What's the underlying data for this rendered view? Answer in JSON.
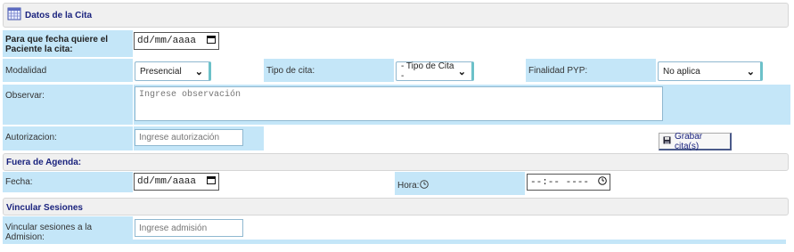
{
  "section_cita": {
    "title": "Datos de la Cita"
  },
  "fecha_cita": {
    "label_line1": "Para que fecha quiere el",
    "label_line2": "Paciente la cita:",
    "value": "dd/mm/aaaa"
  },
  "modalidad": {
    "label": "Modalidad",
    "selected": "Presencial"
  },
  "tipo_cita": {
    "label": "Tipo de cita:",
    "selected": "- Tipo de Cita -"
  },
  "finalidad": {
    "label": "Finalidad PYP:",
    "selected": "No aplica"
  },
  "observar": {
    "label": "Observar:",
    "placeholder": "Ingrese observación"
  },
  "autorizacion": {
    "label": "Autorizacion:",
    "placeholder": "Ingrese autorización"
  },
  "grabar": {
    "label": "Grabar cita(s)"
  },
  "fuera_agenda": {
    "title": "Fuera de Agenda:",
    "fecha_label": "Fecha:",
    "fecha_value": "dd/mm/aaaa",
    "hora_label": "Hora:",
    "hora_value": "--:-- ----"
  },
  "vincular": {
    "title": "Vincular Sesiones",
    "label": "Vincular sesiones a la Admision:",
    "placeholder": "Ingrese admisión"
  },
  "icons": {
    "calendar": "calendar-icon",
    "clock": "clock-icon",
    "save": "floppy-icon",
    "chevron": "chevron-down-icon"
  }
}
